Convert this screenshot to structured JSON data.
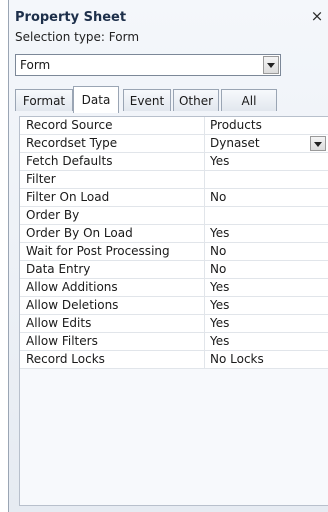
{
  "panel": {
    "title": "Property Sheet",
    "close_glyph": "×",
    "selection_type": "Selection type:  Form",
    "combo_value": "Form"
  },
  "tabs": [
    {
      "label": "Format"
    },
    {
      "label": "Data",
      "active": true
    },
    {
      "label": "Event"
    },
    {
      "label": "Other"
    },
    {
      "label": "All"
    }
  ],
  "properties": [
    {
      "label": "Record Source",
      "value": "Products"
    },
    {
      "label": "Recordset Type",
      "value": "Dynaset",
      "dropdown": true
    },
    {
      "label": "Fetch Defaults",
      "value": "Yes"
    },
    {
      "label": "Filter",
      "value": ""
    },
    {
      "label": "Filter On Load",
      "value": "No"
    },
    {
      "label": "Order By",
      "value": ""
    },
    {
      "label": "Order By On Load",
      "value": "Yes"
    },
    {
      "label": "Wait for Post Processing",
      "value": "No"
    },
    {
      "label": "Data Entry",
      "value": "No"
    },
    {
      "label": "Allow Additions",
      "value": "Yes"
    },
    {
      "label": "Allow Deletions",
      "value": "Yes"
    },
    {
      "label": "Allow Edits",
      "value": "Yes"
    },
    {
      "label": "Allow Filters",
      "value": "Yes"
    },
    {
      "label": "Record Locks",
      "value": "No Locks"
    }
  ]
}
